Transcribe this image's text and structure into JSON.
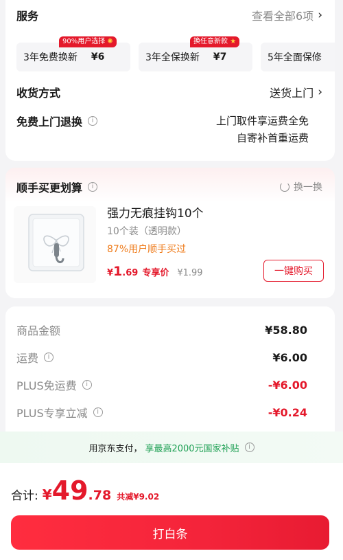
{
  "services": {
    "title": "服务",
    "view_all": "查看全部6项",
    "options": [
      {
        "label": "3年免费换新",
        "price": "¥6",
        "badge": "90%用户选择"
      },
      {
        "label": "3年全保换新",
        "price": "¥7",
        "badge": "换任意新款"
      },
      {
        "label": "5年全面保修",
        "price": "",
        "badge": ""
      }
    ]
  },
  "delivery": {
    "label": "收货方式",
    "value": "送货上门"
  },
  "return": {
    "label": "免费上门退换",
    "line1": "上门取件享运费全免",
    "line2": "自寄补首重运费"
  },
  "bundle": {
    "title": "顺手买更划算",
    "refresh": "换一换",
    "product": {
      "name": "强力无痕挂钩10个",
      "spec": "10个装（透明款）",
      "note": "87%用户顺手买过",
      "price_symbol": "¥",
      "price_int": "1",
      "price_dec": ".69",
      "price_tag": "专享价",
      "original": "¥1.99",
      "button": "一键购买"
    }
  },
  "prices": [
    {
      "key": "商品金额",
      "value": "¥58.80",
      "info": false,
      "red": false
    },
    {
      "key": "运费",
      "value": "¥6.00",
      "info": true,
      "red": false
    },
    {
      "key": "PLUS免运费",
      "value": "-¥6.00",
      "info": true,
      "red": true
    },
    {
      "key": "PLUS专享立减",
      "value": "-¥0.24",
      "info": true,
      "red": true
    }
  ],
  "pay_banner": {
    "text": "用京东支付，",
    "highlight": "享最高2000元国家补贴"
  },
  "total": {
    "label": "合计:",
    "symbol": "¥",
    "int": "49",
    "dec": ".78",
    "saved": "共减¥9.02"
  },
  "pay_button": "打白条",
  "colors": {
    "accent": "#e4192b",
    "note": "#ef7c1c",
    "green": "#1ea054"
  }
}
